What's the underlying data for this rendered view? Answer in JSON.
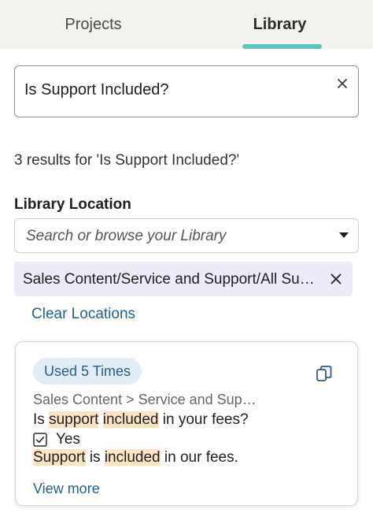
{
  "tabs": [
    {
      "label": "Projects",
      "active": false
    },
    {
      "label": "Library",
      "active": true
    }
  ],
  "colors": {
    "tab_underline": "#5cc5bb",
    "link": "#24608f",
    "chip_bg": "#ecebf7",
    "badge_bg": "#e2edf7",
    "highlight": "#fbe4c6"
  },
  "search": {
    "value": "Is Support Included?",
    "clear_icon": "close-icon"
  },
  "results": {
    "count_text": "3 results for 'Is Support Included?'"
  },
  "library_location": {
    "label": "Library Location",
    "placeholder": "Search or browse your Library",
    "selected_chip": "Sales Content/Service and Support/All Support",
    "clear_label": "Clear Locations"
  },
  "result_card": {
    "usage_badge": "Used 5 Times",
    "breadcrumb": "Sales Content > Service and Support > All Support",
    "question": {
      "p1": "Is ",
      "h1": "support",
      "p2": " ",
      "h2": "included",
      "p3": " in your fees?"
    },
    "answer_option": "Yes",
    "answer": {
      "h1": "Support",
      "p1": " is ",
      "h2": "included",
      "p2": " in our fees."
    },
    "view_more_label": "View more"
  }
}
